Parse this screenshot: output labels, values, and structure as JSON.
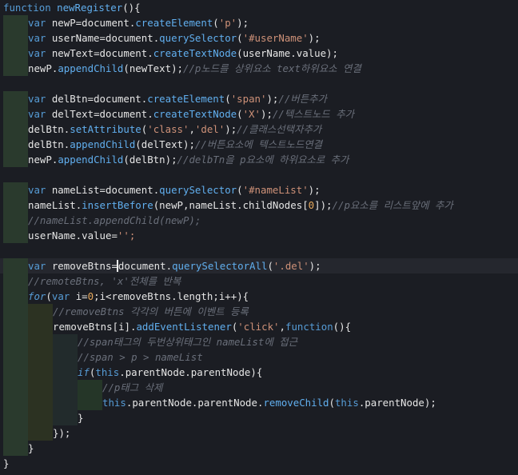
{
  "theme": {
    "background": "#1b1d23",
    "current_line": "#25272e",
    "keyword": "#569cd6",
    "function": "#61afef",
    "string": "#ce9178",
    "comment": "#6a6f7a",
    "number": "#e6a85c",
    "text": "#e6e6e6",
    "indent_guide_1": "#2a3a2d",
    "indent_guide_2": "#2c3222",
    "indent_guide_3": "#222b2c",
    "indent_guide_4": "#253628"
  },
  "editor": {
    "current_line_index": 17,
    "lines": [
      {
        "indent": 0,
        "tokens": [
          {
            "t": "kw",
            "v": "function "
          },
          {
            "t": "func",
            "v": "newRegister"
          },
          {
            "t": "punct",
            "v": "(){"
          }
        ]
      },
      {
        "indent": 1,
        "tokens": [
          {
            "t": "kw",
            "v": "var "
          },
          {
            "t": "var",
            "v": "newP"
          },
          {
            "t": "punct",
            "v": "="
          },
          {
            "t": "var",
            "v": "document"
          },
          {
            "t": "punct",
            "v": "."
          },
          {
            "t": "func",
            "v": "createElement"
          },
          {
            "t": "punct",
            "v": "("
          },
          {
            "t": "str",
            "v": "'p'"
          },
          {
            "t": "punct",
            "v": ");"
          }
        ]
      },
      {
        "indent": 1,
        "tokens": [
          {
            "t": "kw",
            "v": "var "
          },
          {
            "t": "var",
            "v": "userName"
          },
          {
            "t": "punct",
            "v": "="
          },
          {
            "t": "var",
            "v": "document"
          },
          {
            "t": "punct",
            "v": "."
          },
          {
            "t": "func",
            "v": "querySelector"
          },
          {
            "t": "punct",
            "v": "("
          },
          {
            "t": "str",
            "v": "'#userName'"
          },
          {
            "t": "punct",
            "v": ");"
          }
        ]
      },
      {
        "indent": 1,
        "tokens": [
          {
            "t": "kw",
            "v": "var "
          },
          {
            "t": "var",
            "v": "newText"
          },
          {
            "t": "punct",
            "v": "="
          },
          {
            "t": "var",
            "v": "document"
          },
          {
            "t": "punct",
            "v": "."
          },
          {
            "t": "func",
            "v": "createTextNode"
          },
          {
            "t": "punct",
            "v": "("
          },
          {
            "t": "var",
            "v": "userName.value"
          },
          {
            "t": "punct",
            "v": ");"
          }
        ]
      },
      {
        "indent": 1,
        "tokens": [
          {
            "t": "var",
            "v": "newP"
          },
          {
            "t": "punct",
            "v": "."
          },
          {
            "t": "func",
            "v": "appendChild"
          },
          {
            "t": "punct",
            "v": "("
          },
          {
            "t": "var",
            "v": "newText"
          },
          {
            "t": "punct",
            "v": ");"
          },
          {
            "t": "comment",
            "v": "//p노드를 상위요소 text하위요소 연결"
          }
        ]
      },
      {
        "indent": 1,
        "tokens": []
      },
      {
        "indent": 1,
        "tokens": [
          {
            "t": "kw",
            "v": "var "
          },
          {
            "t": "var",
            "v": "delBtn"
          },
          {
            "t": "punct",
            "v": "="
          },
          {
            "t": "var",
            "v": "document"
          },
          {
            "t": "punct",
            "v": "."
          },
          {
            "t": "func",
            "v": "createElement"
          },
          {
            "t": "punct",
            "v": "("
          },
          {
            "t": "str",
            "v": "'span'"
          },
          {
            "t": "punct",
            "v": ");"
          },
          {
            "t": "comment",
            "v": "//버튼추가"
          }
        ]
      },
      {
        "indent": 1,
        "tokens": [
          {
            "t": "kw",
            "v": "var "
          },
          {
            "t": "var",
            "v": "delText"
          },
          {
            "t": "punct",
            "v": "="
          },
          {
            "t": "var",
            "v": "document"
          },
          {
            "t": "punct",
            "v": "."
          },
          {
            "t": "func",
            "v": "createTextNode"
          },
          {
            "t": "punct",
            "v": "("
          },
          {
            "t": "str",
            "v": "'X'"
          },
          {
            "t": "punct",
            "v": ");"
          },
          {
            "t": "comment",
            "v": "//텍스트노드 추가"
          }
        ]
      },
      {
        "indent": 1,
        "tokens": [
          {
            "t": "var",
            "v": "delBtn"
          },
          {
            "t": "punct",
            "v": "."
          },
          {
            "t": "func",
            "v": "setAttribute"
          },
          {
            "t": "punct",
            "v": "("
          },
          {
            "t": "str",
            "v": "'class'"
          },
          {
            "t": "punct",
            "v": ","
          },
          {
            "t": "str",
            "v": "'del'"
          },
          {
            "t": "punct",
            "v": ");"
          },
          {
            "t": "comment",
            "v": "//클래스선택자추가"
          }
        ]
      },
      {
        "indent": 1,
        "tokens": [
          {
            "t": "var",
            "v": "delBtn"
          },
          {
            "t": "punct",
            "v": "."
          },
          {
            "t": "func",
            "v": "appendChild"
          },
          {
            "t": "punct",
            "v": "("
          },
          {
            "t": "var",
            "v": "delText"
          },
          {
            "t": "punct",
            "v": ");"
          },
          {
            "t": "comment",
            "v": "//버튼요소에 텍스트노드연결"
          }
        ]
      },
      {
        "indent": 1,
        "tokens": [
          {
            "t": "var",
            "v": "newP"
          },
          {
            "t": "punct",
            "v": "."
          },
          {
            "t": "func",
            "v": "appendChild"
          },
          {
            "t": "punct",
            "v": "("
          },
          {
            "t": "var",
            "v": "delBtn"
          },
          {
            "t": "punct",
            "v": ");"
          },
          {
            "t": "comment",
            "v": "//delbTn을 p요소에 하위요소로 추가"
          }
        ]
      },
      {
        "indent": 1,
        "tokens": []
      },
      {
        "indent": 1,
        "tokens": [
          {
            "t": "kw",
            "v": "var "
          },
          {
            "t": "var",
            "v": "nameList"
          },
          {
            "t": "punct",
            "v": "="
          },
          {
            "t": "var",
            "v": "document"
          },
          {
            "t": "punct",
            "v": "."
          },
          {
            "t": "func",
            "v": "querySelector"
          },
          {
            "t": "punct",
            "v": "("
          },
          {
            "t": "str",
            "v": "'#nameList'"
          },
          {
            "t": "punct",
            "v": ");"
          }
        ]
      },
      {
        "indent": 1,
        "tokens": [
          {
            "t": "var",
            "v": "nameList"
          },
          {
            "t": "punct",
            "v": "."
          },
          {
            "t": "func",
            "v": "insertBefore"
          },
          {
            "t": "punct",
            "v": "("
          },
          {
            "t": "var",
            "v": "newP,nameList.childNodes"
          },
          {
            "t": "punct",
            "v": "["
          },
          {
            "t": "num",
            "v": "0"
          },
          {
            "t": "punct",
            "v": "]);"
          },
          {
            "t": "comment",
            "v": "//p요소를 리스트앞에 추가"
          }
        ]
      },
      {
        "indent": 1,
        "tokens": [
          {
            "t": "comment",
            "v": "//nameList.appendChild(newP);"
          }
        ]
      },
      {
        "indent": 1,
        "tokens": [
          {
            "t": "var",
            "v": "userName.value"
          },
          {
            "t": "punct",
            "v": "="
          },
          {
            "t": "str",
            "v": "'';"
          }
        ]
      },
      {
        "indent": 1,
        "tokens": []
      },
      {
        "indent": 1,
        "tokens": [
          {
            "t": "kw",
            "v": "var "
          },
          {
            "t": "var",
            "v": "removeBtns"
          },
          {
            "t": "punct",
            "v": "="
          },
          {
            "t": "cursor",
            "v": ""
          },
          {
            "t": "var",
            "v": "document"
          },
          {
            "t": "punct",
            "v": "."
          },
          {
            "t": "func",
            "v": "querySelectorAll"
          },
          {
            "t": "punct",
            "v": "("
          },
          {
            "t": "str",
            "v": "'.del'"
          },
          {
            "t": "punct",
            "v": ");"
          }
        ]
      },
      {
        "indent": 1,
        "tokens": [
          {
            "t": "comment",
            "v": "//remoteBtns, 'x'전체를 반복"
          }
        ]
      },
      {
        "indent": 1,
        "tokens": [
          {
            "t": "kwi",
            "v": "for"
          },
          {
            "t": "punct",
            "v": "("
          },
          {
            "t": "kw",
            "v": "var "
          },
          {
            "t": "var",
            "v": "i"
          },
          {
            "t": "punct",
            "v": "="
          },
          {
            "t": "num",
            "v": "0"
          },
          {
            "t": "punct",
            "v": ";"
          },
          {
            "t": "var",
            "v": "i"
          },
          {
            "t": "punct",
            "v": "<"
          },
          {
            "t": "var",
            "v": "removeBtns.length"
          },
          {
            "t": "punct",
            "v": ";"
          },
          {
            "t": "var",
            "v": "i"
          },
          {
            "t": "punct",
            "v": "++){"
          }
        ]
      },
      {
        "indent": 2,
        "tokens": [
          {
            "t": "comment",
            "v": "//removeBtns 각각의 버튼에 이벤트 등록"
          }
        ]
      },
      {
        "indent": 2,
        "tokens": [
          {
            "t": "var",
            "v": "removeBtns"
          },
          {
            "t": "punct",
            "v": "["
          },
          {
            "t": "var",
            "v": "i"
          },
          {
            "t": "punct",
            "v": "]."
          },
          {
            "t": "func",
            "v": "addEventListener"
          },
          {
            "t": "punct",
            "v": "("
          },
          {
            "t": "str",
            "v": "'click'"
          },
          {
            "t": "punct",
            "v": ","
          },
          {
            "t": "kw",
            "v": "function"
          },
          {
            "t": "punct",
            "v": "(){"
          }
        ]
      },
      {
        "indent": 3,
        "tokens": [
          {
            "t": "comment",
            "v": "//span태그의 두번상위태그인 nameList에 접근"
          }
        ]
      },
      {
        "indent": 3,
        "tokens": [
          {
            "t": "comment",
            "v": "//span > p > nameList"
          }
        ]
      },
      {
        "indent": 3,
        "tokens": [
          {
            "t": "kwi",
            "v": "if"
          },
          {
            "t": "punct",
            "v": "("
          },
          {
            "t": "kw",
            "v": "this"
          },
          {
            "t": "punct",
            "v": "."
          },
          {
            "t": "var",
            "v": "parentNode.parentNode"
          },
          {
            "t": "punct",
            "v": "){"
          }
        ]
      },
      {
        "indent": 4,
        "tokens": [
          {
            "t": "comment",
            "v": "//p태그 삭제"
          }
        ]
      },
      {
        "indent": 4,
        "tokens": [
          {
            "t": "kw",
            "v": "this"
          },
          {
            "t": "punct",
            "v": "."
          },
          {
            "t": "var",
            "v": "parentNode.parentNode"
          },
          {
            "t": "punct",
            "v": "."
          },
          {
            "t": "func",
            "v": "removeChild"
          },
          {
            "t": "punct",
            "v": "("
          },
          {
            "t": "kw",
            "v": "this"
          },
          {
            "t": "punct",
            "v": "."
          },
          {
            "t": "var",
            "v": "parentNode"
          },
          {
            "t": "punct",
            "v": ");"
          }
        ]
      },
      {
        "indent": 3,
        "tokens": [
          {
            "t": "punct",
            "v": "}"
          }
        ]
      },
      {
        "indent": 2,
        "tokens": [
          {
            "t": "punct",
            "v": "});"
          }
        ]
      },
      {
        "indent": 1,
        "tokens": [
          {
            "t": "punct",
            "v": "}"
          }
        ]
      },
      {
        "indent": 0,
        "tokens": [
          {
            "t": "punct",
            "v": "}"
          }
        ]
      }
    ]
  }
}
